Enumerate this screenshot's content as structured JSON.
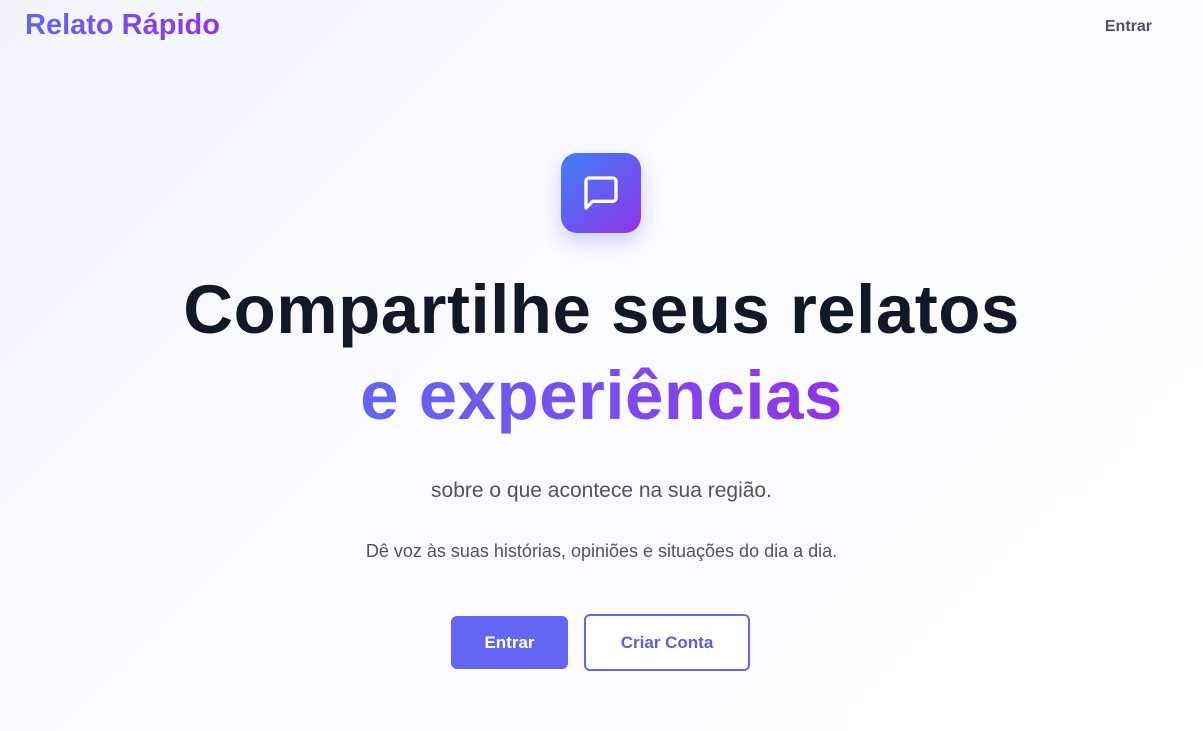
{
  "header": {
    "brand": "Relato Rápido",
    "login_link": "Entrar"
  },
  "hero": {
    "icon": "message-square-icon",
    "title_line1": "Compartilhe seus relatos",
    "title_line2": "e experiências",
    "subtitle": "sobre o que acontece na sua região.",
    "description": "Dê voz às suas histórias, opiniões e situações do dia a dia.",
    "primary_button": "Entrar",
    "secondary_button": "Criar Conta"
  },
  "colors": {
    "accent": "#6366f1",
    "accent_gradient_end": "#9333ea",
    "icon_gradient_start": "#3b82f6",
    "title": "#111827",
    "muted_text": "#4b5563"
  }
}
